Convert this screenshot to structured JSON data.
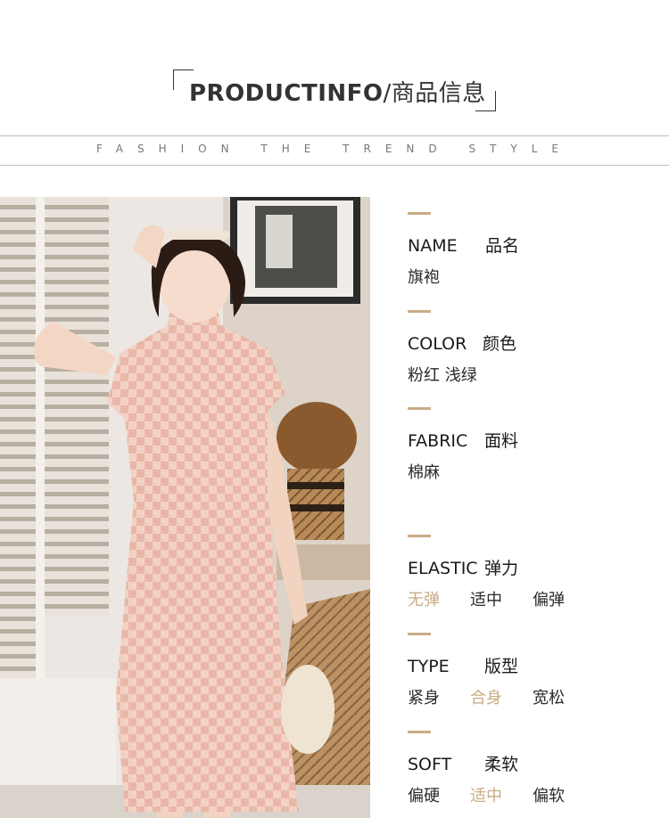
{
  "header": {
    "title_en": "PRODUCTINFO",
    "title_sep": "/",
    "title_cn": "商品信息",
    "slogan": "FASHION THE TREND STYLE"
  },
  "colors": {
    "accent": "#c8ab86",
    "text": "#222222",
    "line": "#bdbdbd"
  },
  "specs": {
    "name": {
      "en": "NAME",
      "cn": "品名",
      "value": "旗袍"
    },
    "color": {
      "en": "COLOR",
      "cn": "颜色",
      "value": "粉红 浅绿"
    },
    "fabric": {
      "en": "FABRIC",
      "cn": "面料",
      "value": "棉麻"
    },
    "elastic": {
      "en": "ELASTIC",
      "cn": "弹力",
      "options": [
        "无弹",
        "适中",
        "偏弹"
      ],
      "selected": "无弹"
    },
    "type": {
      "en": "TYPE",
      "cn": "版型",
      "options": [
        "紧身",
        "合身",
        "宽松"
      ],
      "selected": "合身"
    },
    "soft": {
      "en": "SOFT",
      "cn": "柔软",
      "options": [
        "偏硬",
        "适中",
        "偏软"
      ],
      "selected": "适中"
    }
  }
}
